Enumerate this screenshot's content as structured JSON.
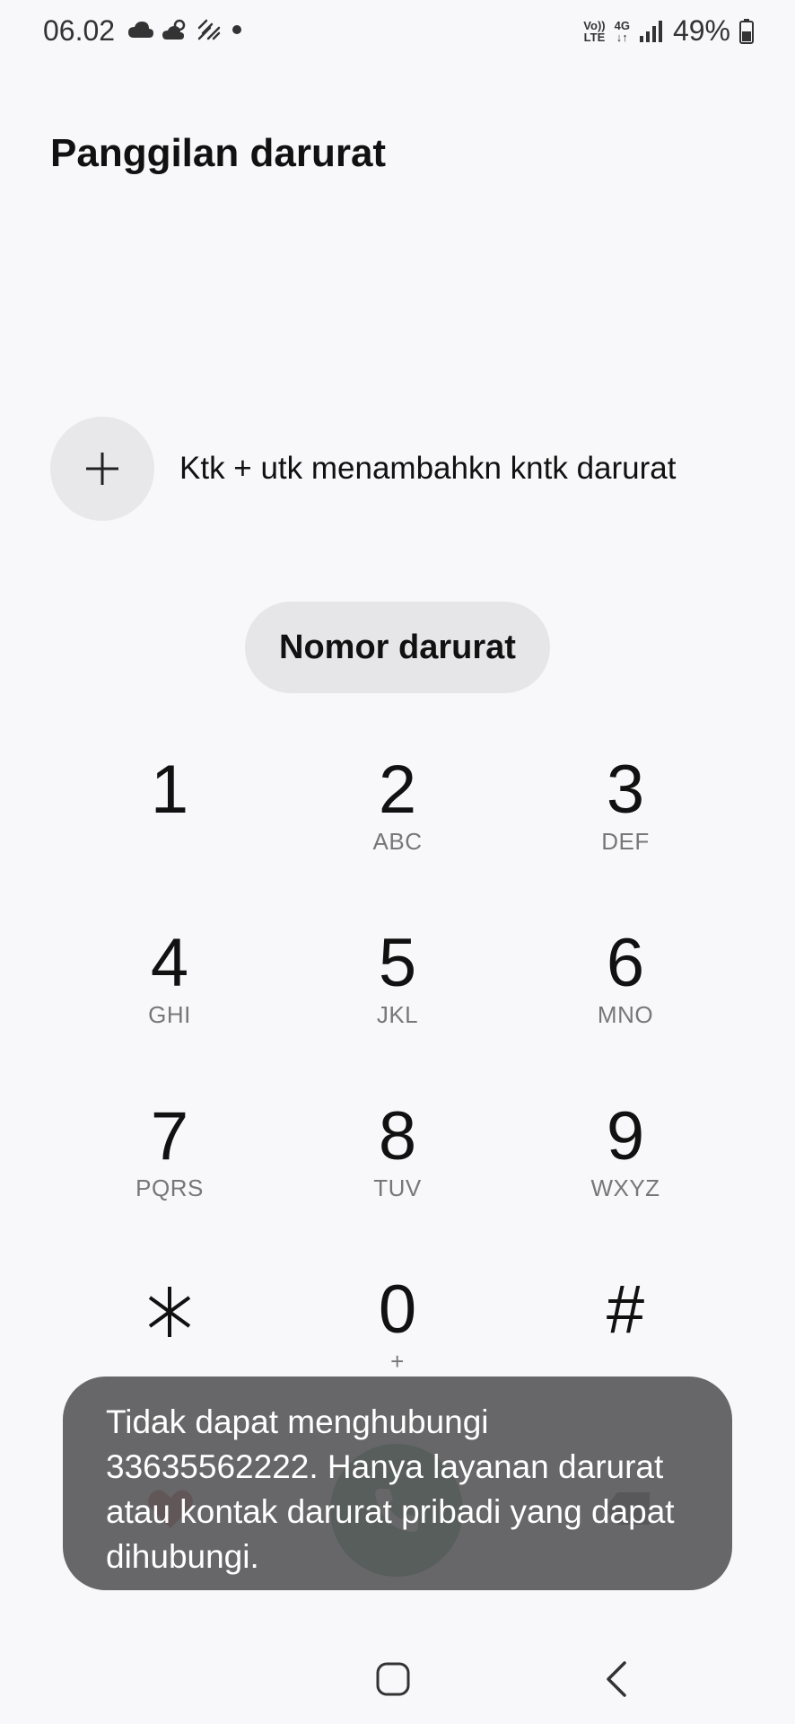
{
  "status_bar": {
    "time": "06.02",
    "battery": "49%",
    "network_top": "Vo))",
    "network_bottom": "LTE",
    "gen_top": "4G",
    "gen_bottom": "↓↑",
    "icons": [
      "cloud-icon",
      "partly-cloudy-icon",
      "haze-icon",
      "notification-dot-icon",
      "volte-icon",
      "4g-icon",
      "signal-icon",
      "battery-icon"
    ]
  },
  "page": {
    "title": "Panggilan darurat"
  },
  "add_contact": {
    "icon": "plus-icon",
    "label": "Ktk + utk menambahkn kntk darurat"
  },
  "emergency_numbers_button": "Nomor darurat",
  "keypad": [
    {
      "digit": "1",
      "letters": ""
    },
    {
      "digit": "2",
      "letters": "ABC"
    },
    {
      "digit": "3",
      "letters": "DEF"
    },
    {
      "digit": "4",
      "letters": "GHI"
    },
    {
      "digit": "5",
      "letters": "JKL"
    },
    {
      "digit": "6",
      "letters": "MNO"
    },
    {
      "digit": "7",
      "letters": "PQRS"
    },
    {
      "digit": "8",
      "letters": "TUV"
    },
    {
      "digit": "9",
      "letters": "WXYZ"
    },
    {
      "digit": "*",
      "letters": ""
    },
    {
      "digit": "0",
      "letters": "+"
    },
    {
      "digit": "#",
      "letters": ""
    }
  ],
  "colors": {
    "background": "#f8f8fa",
    "call_green": "#3c8f4f",
    "toast_bg": "#5a5a5c"
  },
  "toast": {
    "message": "Tidak dapat menghubungi 33635562222. Hanya layanan darurat atau kontak darurat pribadi yang dapat dihubungi."
  },
  "nav": {
    "home_icon": "home-icon",
    "back_icon": "back-icon"
  }
}
